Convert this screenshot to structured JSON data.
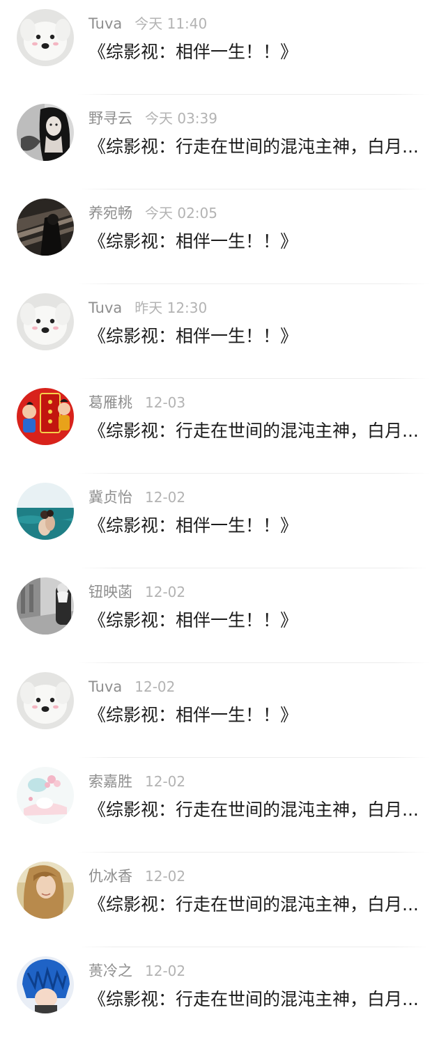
{
  "comments": [
    {
      "name": "Tuva",
      "time": "今天 11:40",
      "text": "《综影视：相伴一生！！》",
      "avatar": "white-dog-avatar"
    },
    {
      "name": "野寻云",
      "time": "今天 03:39",
      "text": "《综影视：行走在世间的混沌主神，白月...",
      "avatar": "woman-bw-avatar"
    },
    {
      "name": "养宛畅",
      "time": "今天 02:05",
      "text": "《综影视：相伴一生！！》",
      "avatar": "dark-railway-avatar"
    },
    {
      "name": "Tuva",
      "time": "昨天 12:30",
      "text": "《综影视：相伴一生！！》",
      "avatar": "white-dog-avatar"
    },
    {
      "name": "葛雁桃",
      "time": "12-03",
      "text": "《综影视：行走在世间的混沌主神，白月...",
      "avatar": "new-year-avatar"
    },
    {
      "name": "冀贞怡",
      "time": "12-02",
      "text": "《综影视：相伴一生！！》",
      "avatar": "sea-couple-avatar"
    },
    {
      "name": "钮映菡",
      "time": "12-02",
      "text": "《综影视：相伴一生！！》",
      "avatar": "street-bw-avatar"
    },
    {
      "name": "Tuva",
      "time": "12-02",
      "text": "《综影视：相伴一生！！》",
      "avatar": "white-dog-avatar"
    },
    {
      "name": "索嘉胜",
      "time": "12-02",
      "text": "《综影视：行走在世间的混沌主神，白月...",
      "avatar": "pastel-flower-avatar"
    },
    {
      "name": "仇冰香",
      "time": "12-02",
      "text": "《综影视：行走在世间的混沌主神，白月...",
      "avatar": "blonde-girl-avatar"
    },
    {
      "name": "蒉冷之",
      "time": "12-02",
      "text": "《综影视：行走在世间的混沌主神，白月...",
      "avatar": "blue-hair-avatar"
    }
  ]
}
